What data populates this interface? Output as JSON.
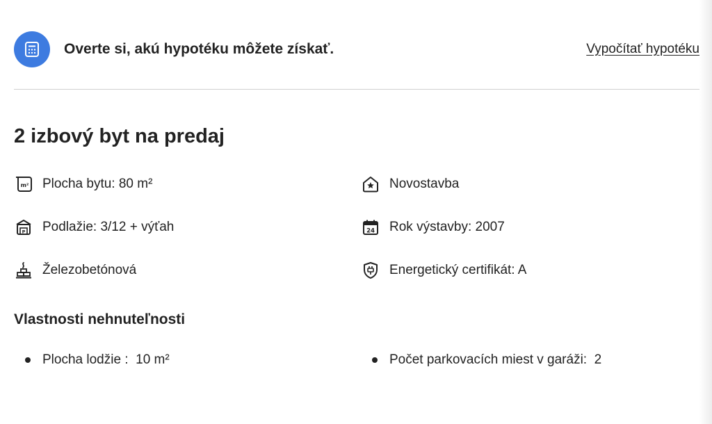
{
  "banner": {
    "icon": "calculator-icon",
    "text": "Overte si, akú hypotéku môžete získať.",
    "link_label": "Vypočítať hypotéku",
    "accent_color": "#3d7be0"
  },
  "listing": {
    "title": "2 izbový byt na predaj",
    "features": [
      {
        "icon": "area-m2-icon",
        "label": "Plocha bytu: 80 m²"
      },
      {
        "icon": "house-star-icon",
        "label": "Novostavba"
      },
      {
        "icon": "floor-icon",
        "label": "Podlažie: 3/12 + výťah"
      },
      {
        "icon": "calendar-icon",
        "label": "Rok výstavby: 2007"
      },
      {
        "icon": "bricks-icon",
        "label": "Železobetónová"
      },
      {
        "icon": "energy-certificate-icon",
        "label": "Energetický certifikát: A"
      }
    ]
  },
  "properties": {
    "title": "Vlastnosti nehnuteľnosti",
    "items": [
      {
        "label": "Plocha lodžie :  10 m²"
      },
      {
        "label": "Počet parkovacích miest v garáži:  2"
      }
    ]
  }
}
